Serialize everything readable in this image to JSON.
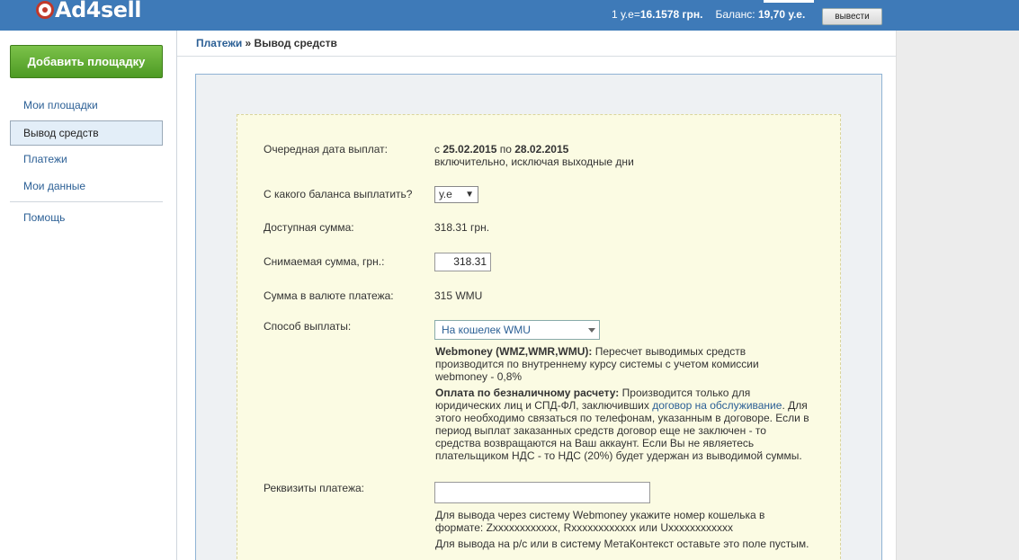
{
  "header": {
    "logo": "Ad4sell",
    "rate_label": "1 у.е=",
    "rate_value": "16.1578 грн.",
    "balance_label": "Баланс:",
    "balance_value": "19,70 у.е.",
    "logout_label": "вывести"
  },
  "sidebar": {
    "add_button": "Добавить площадку",
    "items": [
      {
        "label": "Мои площадки"
      },
      {
        "label": "Вывод средств"
      },
      {
        "label": "Платежи"
      },
      {
        "label": "Мои данные"
      },
      {
        "label": "Помощь"
      }
    ]
  },
  "breadcrumb": {
    "parent": "Платежи",
    "separator": " » ",
    "current": "Вывод средств"
  },
  "form": {
    "payout_date_label": "Очередная дата выплат:",
    "payout_from": "с ",
    "payout_date_from": "25.02.2015",
    "payout_to": " по ",
    "payout_date_to": "28.02.2015",
    "payout_note": "включительно, исключая выходные дни",
    "balance_source_label": "С какого баланса выплатить?",
    "balance_source_value": "у.е",
    "available_label": "Доступная сумма:",
    "available_value": "318.31 грн.",
    "withdraw_label": "Снимаемая сумма, грн.:",
    "withdraw_value": "318.31",
    "currency_sum_label": "Сумма в валюте платежа:",
    "currency_sum_value": "315 WMU",
    "method_label": "Способ выплаты:",
    "method_value": "На кошелек WMU",
    "webmoney_title": "Webmoney (WMZ,WMR,WMU):",
    "webmoney_text": " Пересчет выводимых средств производится по внутреннему курсу системы с учетом комиссии webmoney - 0,8%",
    "cashless_title": "Оплата по безналичному расчету:",
    "cashless_text_1": " Производится только для юридических лиц и СПД-ФЛ, заключивших ",
    "cashless_link": "договор на обслуживание",
    "cashless_text_2": ". Для этого необходимо связаться по телефонам, указанным в договоре. Если в период выплат заказанных средств договор еще не заключен - то средства возвращаются на Ваш аккаунт. Если Вы не являетесь плательщиком НДС - то НДС (20%) будет удержан из выводимой суммы.",
    "requisites_label": "Реквизиты платежа:",
    "requisites_value": "",
    "requisites_hint_1": "Для вывода через систему Webmoney укажите номер кошелька в формате: Zxxxxxxxxxxxx, Rxxxxxxxxxxxx или Uxxxxxxxxxxxx",
    "requisites_hint_2": "Для вывода на р/с или в систему МетаКонтекст оставьте это поле пустым."
  }
}
